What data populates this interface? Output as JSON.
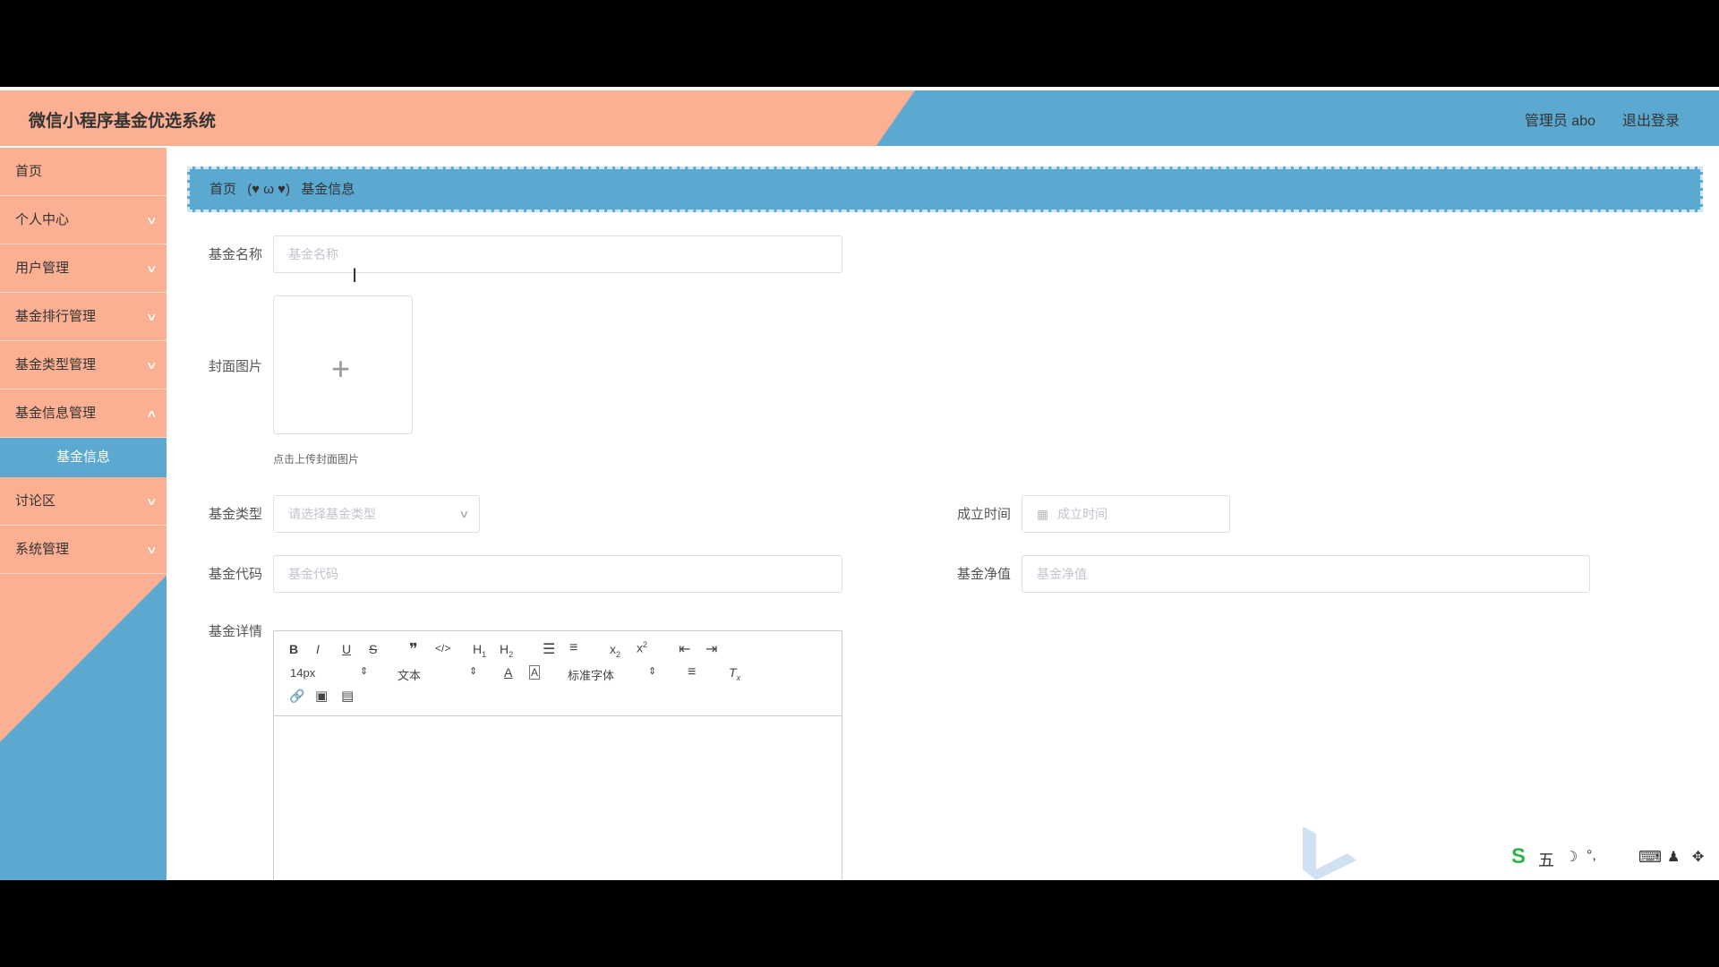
{
  "header": {
    "title": "微信小程序基金优选系统",
    "user": "管理员 abo",
    "logout": "退出登录"
  },
  "sidebar": {
    "items": [
      {
        "label": "首页"
      },
      {
        "label": "个人中心"
      },
      {
        "label": "用户管理"
      },
      {
        "label": "基金排行管理"
      },
      {
        "label": "基金类型管理"
      },
      {
        "label": "基金信息管理"
      }
    ],
    "active_sub": "基金信息",
    "items_after": [
      {
        "label": "讨论区"
      },
      {
        "label": "系统管理"
      }
    ]
  },
  "breadcrumb": {
    "home": "首页",
    "separator": "(♥ ω ♥)",
    "current": "基金信息"
  },
  "form": {
    "name_label": "基金名称",
    "name_placeholder": "基金名称",
    "cover_label": "封面图片",
    "cover_hint": "点击上传封面图片",
    "type_label": "基金类型",
    "type_placeholder": "请选择基金类型",
    "date_label": "成立时间",
    "date_placeholder": "成立时间",
    "code_label": "基金代码",
    "code_placeholder": "基金代码",
    "nav_label": "基金净值",
    "nav_placeholder": "基金净值",
    "detail_label": "基金详情"
  },
  "editor": {
    "font_size": "14px",
    "block_type": "文本",
    "font_family": "标准字体"
  },
  "ime": {
    "mode": "五"
  },
  "colors": {
    "peach": "#fcb093",
    "blue": "#5ba9d1"
  }
}
